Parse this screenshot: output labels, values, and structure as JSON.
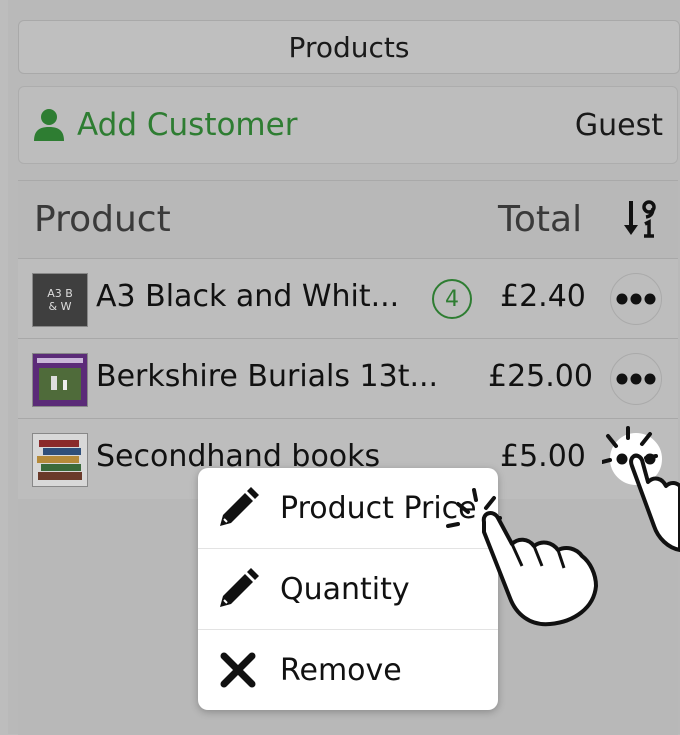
{
  "header": {
    "title": "Products"
  },
  "customer": {
    "add_label": "Add Customer",
    "current": "Guest"
  },
  "list": {
    "columns": {
      "product": "Product",
      "total": "Total"
    },
    "items": [
      {
        "name": "A3 Black and Whit...",
        "quantity": "4",
        "price": "£2.40",
        "thumb_text": "A3 B & W"
      },
      {
        "name": "Berkshire Burials 13t...",
        "price": "£25.00"
      },
      {
        "name": "Secondhand books",
        "price": "£5.00"
      }
    ]
  },
  "context_menu": {
    "items": [
      {
        "label": "Product Price",
        "icon": "pencil-icon"
      },
      {
        "label": "Quantity",
        "icon": "pencil-icon"
      },
      {
        "label": "Remove",
        "icon": "close-icon"
      }
    ]
  },
  "colors": {
    "accent": "#2e7d32",
    "overlay": "#b9b9b9",
    "menu_bg": "#ffffff"
  }
}
